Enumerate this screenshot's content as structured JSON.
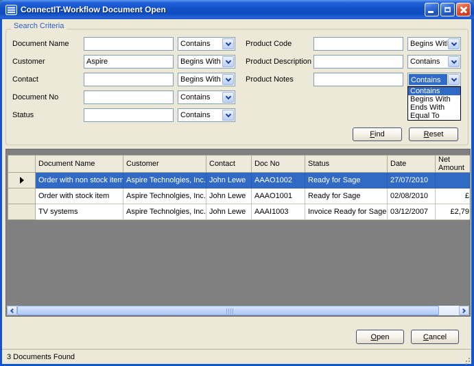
{
  "titlebar": {
    "title": "ConnectIT-Workflow Document Open"
  },
  "search": {
    "group_label": "Search Criteria",
    "rows_left": [
      {
        "label": "Document Name",
        "value": "",
        "match": "Contains"
      },
      {
        "label": "Customer",
        "value": "Aspire",
        "match": "Begins With"
      },
      {
        "label": "Contact",
        "value": "",
        "match": "Begins With"
      },
      {
        "label": "Document No",
        "value": "",
        "match": "Contains"
      },
      {
        "label": "Status",
        "value": "",
        "match": "Contains"
      }
    ],
    "rows_right": [
      {
        "label": "Product Code",
        "value": "",
        "match": "Begins With"
      },
      {
        "label": "Product Description",
        "value": "",
        "match": "Contains"
      },
      {
        "label": "Product Notes",
        "value": "",
        "match": "Contains"
      }
    ],
    "open_dropdown": {
      "options": [
        "Contains",
        "Begins With",
        "Ends With",
        "Equal To"
      ],
      "selected": "Contains"
    },
    "buttons": {
      "find": "Find",
      "reset": "Reset"
    }
  },
  "grid": {
    "columns": [
      "Document Name",
      "Customer",
      "Contact",
      "Doc No",
      "Status",
      "Date",
      "Net Amount"
    ],
    "rows": [
      {
        "document_name": "Order with non stock item",
        "customer": "Aspire Technolgies, Inc.",
        "contact": "John Lewe",
        "doc_no": "AAAO1002",
        "status": "Ready for Sage",
        "date": "27/07/2010",
        "net_amount": "",
        "selected": true
      },
      {
        "document_name": "Order with stock item",
        "customer": "Aspire Technolgies, Inc.",
        "contact": "John Lewe",
        "doc_no": "AAAO1001",
        "status": "Ready for Sage",
        "date": "02/08/2010",
        "net_amount": "£",
        "selected": false
      },
      {
        "document_name": "TV systems",
        "customer": "Aspire Technolgies, Inc.",
        "contact": "John Lewe",
        "doc_no": "AAAI1003",
        "status": "Invoice Ready for Sage",
        "date": "03/12/2007",
        "net_amount": "£2,79",
        "selected": false
      }
    ]
  },
  "footer": {
    "open": "Open",
    "cancel": "Cancel"
  },
  "statusbar": {
    "text": "3 Documents Found"
  },
  "colors": {
    "titlebar_blue": "#1250C8",
    "window_border": "#1253CE",
    "dialog_bg": "#ECE9D8",
    "selection_blue": "#316AC5",
    "close_red": "#D9502E",
    "grid_background": "#808080",
    "group_label_blue": "#2B5FC7",
    "input_border": "#7F9DB9"
  }
}
